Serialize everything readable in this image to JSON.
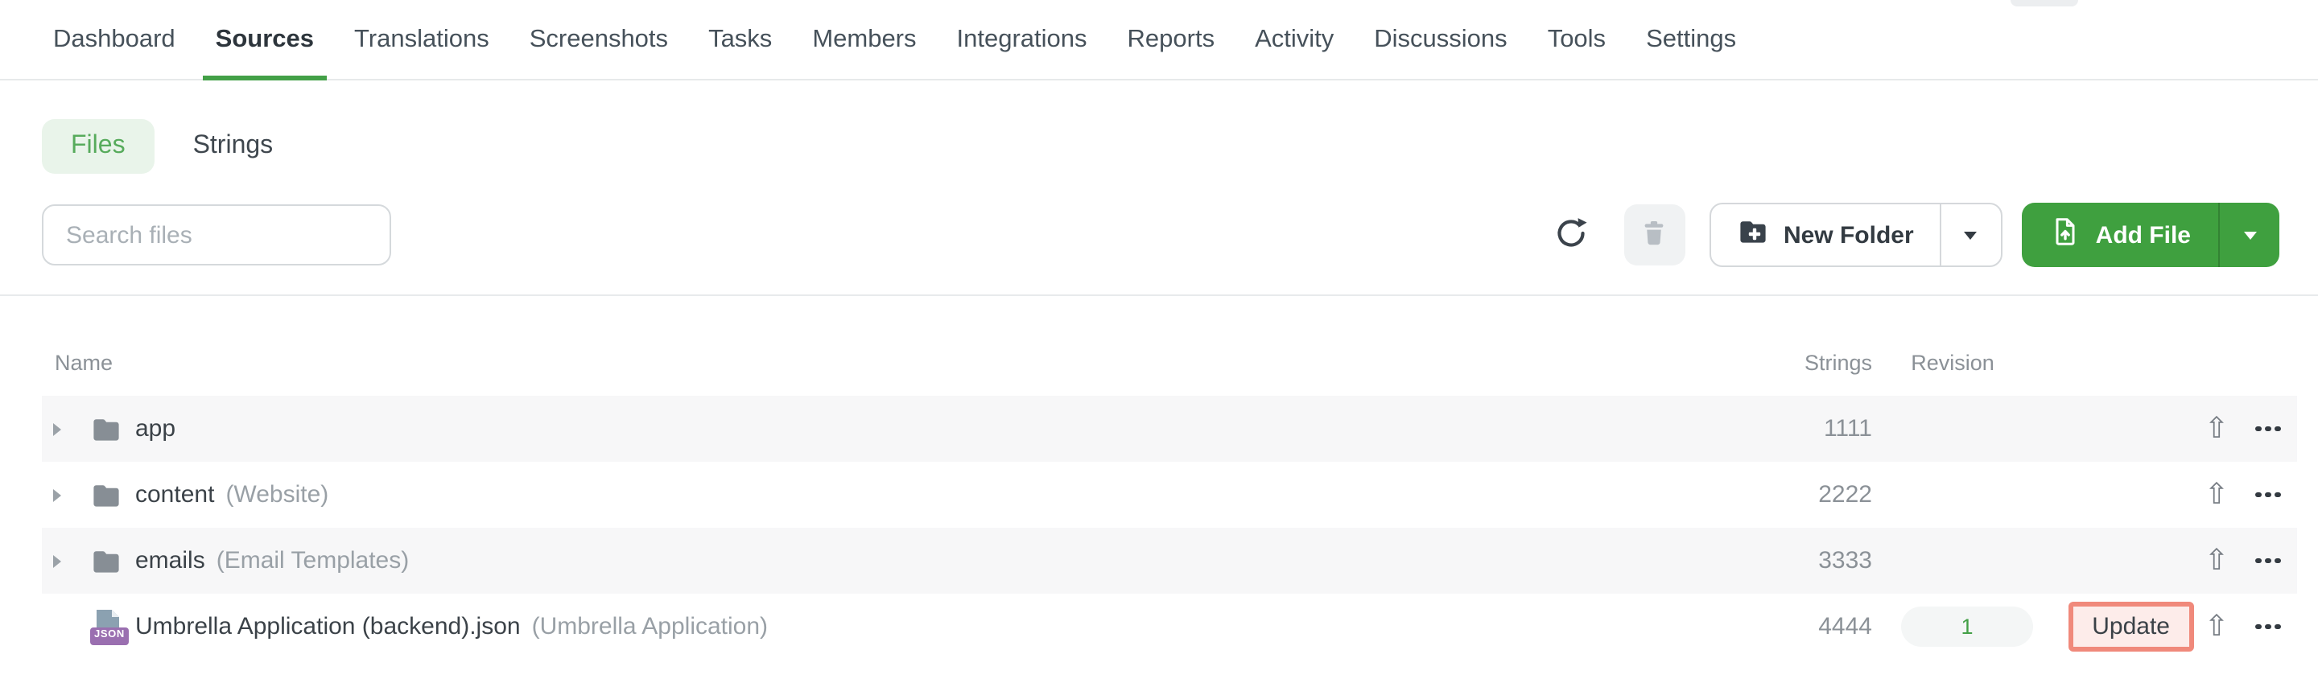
{
  "nav": {
    "items": [
      {
        "label": "Dashboard",
        "active": false
      },
      {
        "label": "Sources",
        "active": true
      },
      {
        "label": "Translations",
        "active": false
      },
      {
        "label": "Screenshots",
        "active": false
      },
      {
        "label": "Tasks",
        "active": false
      },
      {
        "label": "Members",
        "active": false
      },
      {
        "label": "Integrations",
        "active": false
      },
      {
        "label": "Reports",
        "active": false
      },
      {
        "label": "Activity",
        "active": false
      },
      {
        "label": "Discussions",
        "active": false
      },
      {
        "label": "Tools",
        "active": false
      },
      {
        "label": "Settings",
        "active": false
      }
    ],
    "underline_color": "#43a047"
  },
  "subtabs": {
    "files": "Files",
    "strings": "Strings",
    "files_pill_bg": "#e9f4ea",
    "files_pill_text": "#57ab5c"
  },
  "toolbar": {
    "search_placeholder": "Search files",
    "new_folder_label": "New Folder",
    "add_file_label": "Add File",
    "add_file_bg": "#3fa03f"
  },
  "icons": {
    "refresh": "refresh-circular-arrow",
    "delete": "trash-can",
    "new_folder": "folder-plus",
    "add_file": "file-upload",
    "dropdown": "caret-down",
    "expand": "caret-right",
    "folder": "folder",
    "upload": "upload-arrow",
    "upload_glyph": "⇧",
    "more": "ellipsis"
  },
  "table": {
    "headers": {
      "name": "Name",
      "strings": "Strings",
      "revision": "Revision"
    },
    "rows": [
      {
        "kind": "folder",
        "name": "app",
        "annotation": "",
        "strings": "1111"
      },
      {
        "kind": "folder",
        "name": "content",
        "annotation": "(Website)",
        "strings": "2222"
      },
      {
        "kind": "folder",
        "name": "emails",
        "annotation": "(Email Templates)",
        "strings": "3333"
      },
      {
        "kind": "file",
        "badge": "JSON",
        "name": "Umbrella Application (backend).json",
        "annotation": "(Umbrella Application)",
        "strings": "4444",
        "revision": "1",
        "action": "Update"
      }
    ]
  },
  "colors": {
    "accent_green": "#43a047",
    "update_border": "#f0897b",
    "update_bg": "#fdecea",
    "revision_text": "#43a047",
    "json_badge_bg": "#9a6fb0",
    "row_stripe": "#f7f7f8"
  }
}
